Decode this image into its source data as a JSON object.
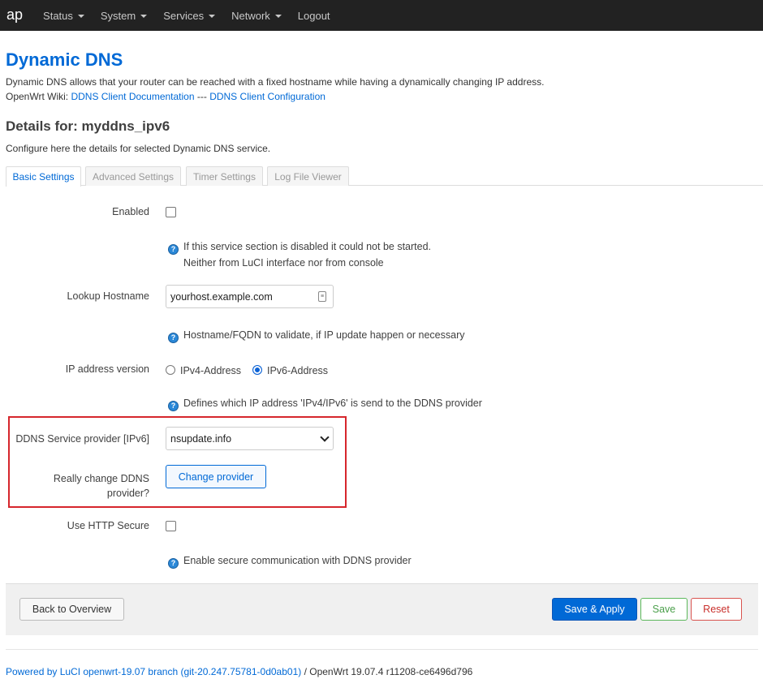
{
  "nav": {
    "brand": "ap",
    "menus": [
      {
        "label": "Status",
        "dropdown": true
      },
      {
        "label": "System",
        "dropdown": true
      },
      {
        "label": "Services",
        "dropdown": true
      },
      {
        "label": "Network",
        "dropdown": true
      },
      {
        "label": "Logout",
        "dropdown": false
      }
    ]
  },
  "page": {
    "title": "Dynamic DNS",
    "description": "Dynamic DNS allows that your router can be reached with a fixed hostname while having a dynamically changing IP address.",
    "wiki_prefix": "OpenWrt Wiki: ",
    "wiki_link1": "DDNS Client Documentation",
    "wiki_separator": " --- ",
    "wiki_link2": "DDNS Client Configuration"
  },
  "details": {
    "title": "Details for: myddns_ipv6",
    "subtitle": "Configure here the details for selected Dynamic DNS service."
  },
  "tabs": [
    "Basic Settings",
    "Advanced Settings",
    "Timer Settings",
    "Log File Viewer"
  ],
  "form": {
    "enabled": {
      "label": "Enabled",
      "checked": false,
      "help_line1": "If this service section is disabled it could not be started.",
      "help_line2": "Neither from LuCI interface nor from console"
    },
    "lookup_hostname": {
      "label": "Lookup Hostname",
      "value": "yourhost.example.com",
      "help": "Hostname/FQDN to validate, if IP update happen or necessary"
    },
    "ip_version": {
      "label": "IP address version",
      "option_ipv4": "IPv4-Address",
      "option_ipv6": "IPv6-Address",
      "selected": "IPv6-Address",
      "help": "Defines which IP address 'IPv4/IPv6' is send to the DDNS provider"
    },
    "service_provider": {
      "label": "DDNS Service provider [IPv6]",
      "value": "nsupdate.info"
    },
    "change_provider": {
      "label_line1": "Really change DDNS",
      "label_line2": "provider?",
      "button": "Change provider"
    },
    "http_secure": {
      "label": "Use HTTP Secure",
      "checked": false,
      "help": "Enable secure communication with DDNS provider"
    }
  },
  "actions": {
    "back": "Back to Overview",
    "save_apply": "Save & Apply",
    "save": "Save",
    "reset": "Reset"
  },
  "footer": {
    "link": "Powered by LuCI openwrt-19.07 branch (git-20.247.75781-0d0ab01)",
    "text": " / OpenWrt 19.07.4 r11208-ce6496d796"
  },
  "colors": {
    "topbar": "#222222",
    "accent": "#0069d6",
    "highlight": "#d6262c"
  }
}
